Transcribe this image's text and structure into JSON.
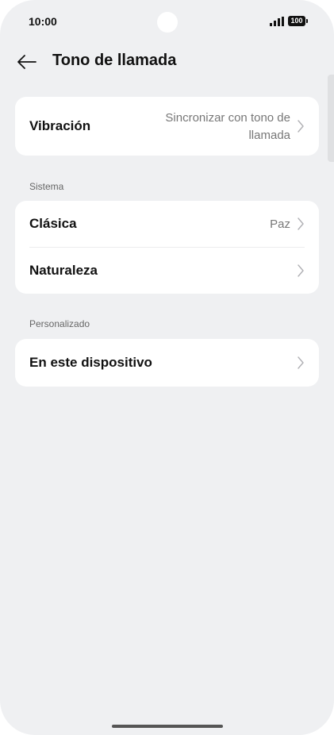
{
  "status_bar": {
    "time": "10:00",
    "battery": "100"
  },
  "header": {
    "back_icon": "arrow-left-icon",
    "title": "Tono de llamada"
  },
  "vibration": {
    "label": "Vibración",
    "value_line1": "Sincronizar con tono de",
    "value_line2": "llamada"
  },
  "system_section": {
    "label": "Sistema",
    "items": [
      {
        "label": "Clásica",
        "value": "Paz"
      },
      {
        "label": "Naturaleza",
        "value": ""
      }
    ]
  },
  "custom_section": {
    "label": "Personalizado",
    "items": [
      {
        "label": "En este dispositivo",
        "value": ""
      }
    ]
  },
  "colors": {
    "background": "#eff0f2",
    "card": "#ffffff",
    "text": "#111111",
    "secondary_text": "#777777"
  }
}
